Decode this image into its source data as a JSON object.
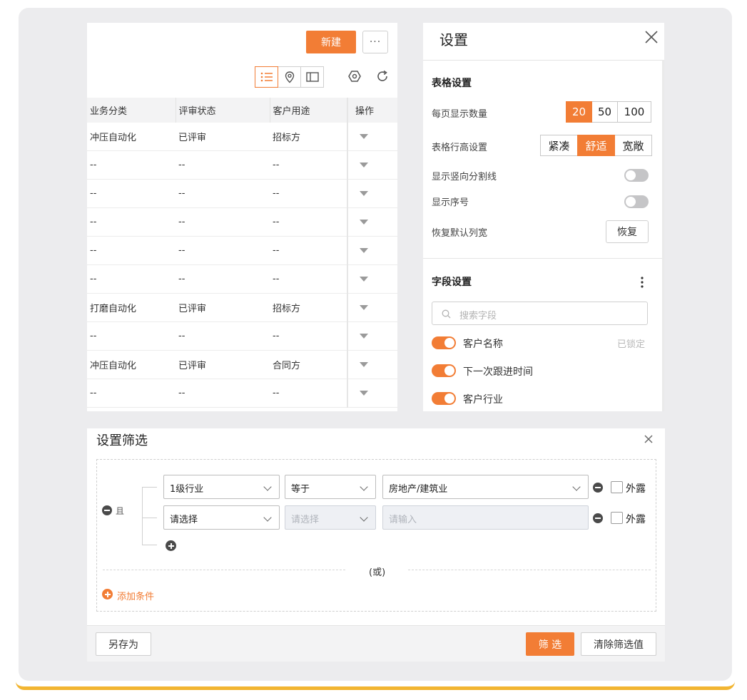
{
  "colors": {
    "accent": "#f27d35",
    "bottom_line": "#f2b531"
  },
  "table_panel": {
    "new_button": "新建",
    "more_button": "···",
    "view_icons": [
      "list-icon",
      "location-pin-icon",
      "panel-icon"
    ],
    "tool_icons": [
      "settings-hexagon-icon",
      "refresh-icon"
    ],
    "columns": [
      "业务分类",
      "评审状态",
      "客户用途",
      "操作"
    ],
    "rows": [
      [
        "冲压自动化",
        "已评审",
        "招标方"
      ],
      [
        "--",
        "--",
        "--"
      ],
      [
        "--",
        "--",
        "--"
      ],
      [
        "--",
        "--",
        "--"
      ],
      [
        "--",
        "--",
        "--"
      ],
      [
        "--",
        "--",
        "--"
      ],
      [
        "打磨自动化",
        "已评审",
        "招标方"
      ],
      [
        "--",
        "--",
        "--"
      ],
      [
        "冲压自动化",
        "已评审",
        "合同方"
      ],
      [
        "--",
        "--",
        "--"
      ]
    ]
  },
  "settings_panel": {
    "title": "设置",
    "table_section": "表格设置",
    "page_size_label": "每页显示数量",
    "page_size_options": [
      "20",
      "50",
      "100"
    ],
    "page_size_selected": "20",
    "row_height_label": "表格行高设置",
    "row_height_options": [
      "紧凑",
      "舒适",
      "宽敞"
    ],
    "row_height_selected": "舒适",
    "vertical_divider_label": "显示竖向分割线",
    "vertical_divider_on": false,
    "show_index_label": "显示序号",
    "show_index_on": false,
    "restore_width_label": "恢复默认列宽",
    "restore_button": "恢复",
    "field_section": "字段设置",
    "search_placeholder": "搜索字段",
    "fields": [
      {
        "label": "客户名称",
        "on": true,
        "note": "已锁定"
      },
      {
        "label": "下一次跟进时间",
        "on": true
      },
      {
        "label": "客户行业",
        "on": true
      }
    ]
  },
  "filter_panel": {
    "title": "设置筛选",
    "and_label": "且",
    "rows": [
      {
        "field": "1级行业",
        "operator": "等于",
        "value": "房地产/建筑业",
        "expose": "外露"
      },
      {
        "field": "请选择",
        "operator": "请选择",
        "value_placeholder": "请输入",
        "expose": "外露"
      }
    ],
    "or_label": "(或)",
    "add_condition": "添加条件",
    "save_as": "另存为",
    "filter_button": "筛 选",
    "clear_button": "清除筛选值"
  }
}
